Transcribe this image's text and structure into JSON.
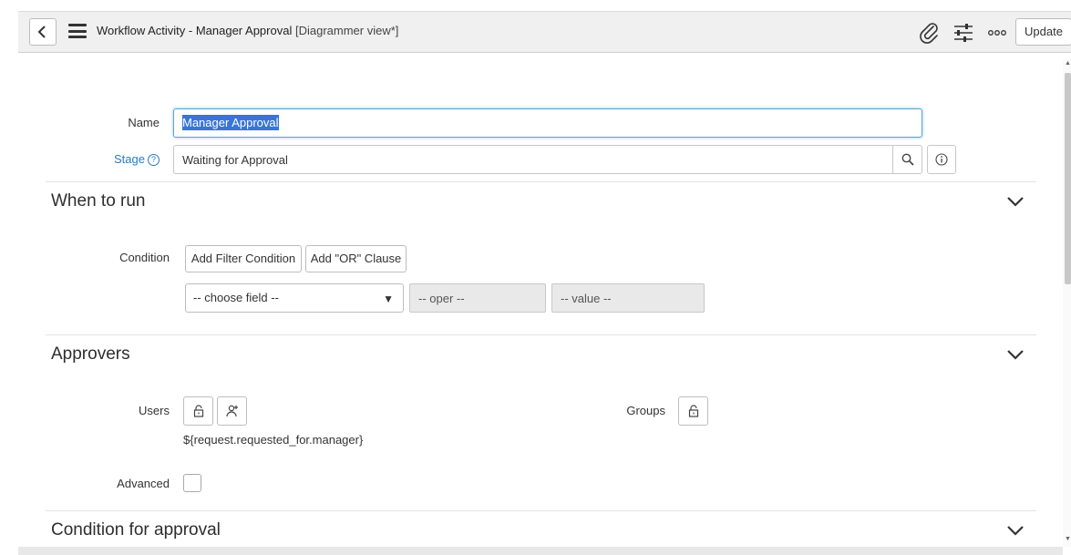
{
  "header": {
    "title": "Workflow Activity - Manager Approval",
    "view": "[Diagrammer view*]",
    "update_label": "Update",
    "icons": [
      "back-icon",
      "menu-icon",
      "paperclip-icon",
      "sliders-icon",
      "more-icon"
    ]
  },
  "form": {
    "name_label": "Name",
    "name_value": "Manager Approval",
    "stage_label": "Stage",
    "stage_help": "?",
    "stage_value": "Waiting for Approval"
  },
  "sections": {
    "when_to_run": {
      "title": "When to run",
      "condition_label": "Condition",
      "add_filter_label": "Add Filter Condition",
      "add_or_label": "Add \"OR\" Clause",
      "field_placeholder": "-- choose field --",
      "oper_placeholder": "-- oper --",
      "value_placeholder": "-- value --"
    },
    "approvers": {
      "title": "Approvers",
      "users_label": "Users",
      "groups_label": "Groups",
      "users_value": "${request.requested_for.manager}",
      "advanced_label": "Advanced",
      "advanced_checked": false
    },
    "condition_for_approval": {
      "title": "Condition for approval"
    }
  },
  "colors": {
    "accent": "#2a7bbf",
    "selection": "#3875d7",
    "focus_border": "#5da5d9",
    "header_bg": "#f0f0f0"
  }
}
